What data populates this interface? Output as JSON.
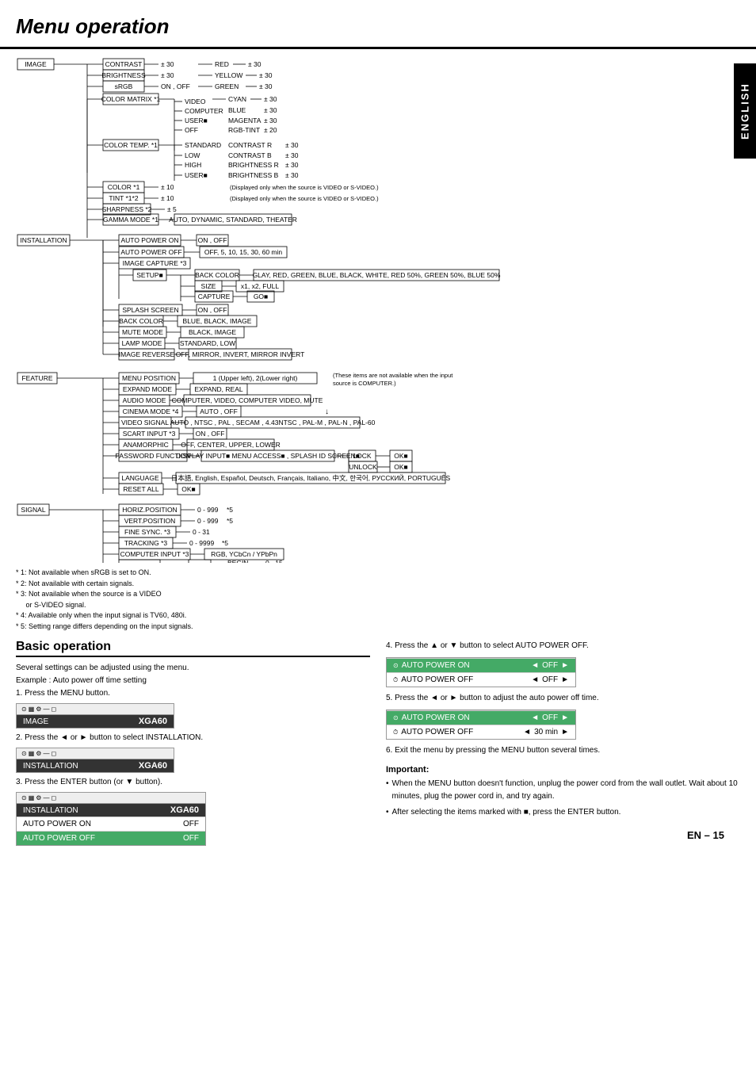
{
  "page": {
    "title": "Menu operation",
    "page_number": "EN – 15",
    "sidebar_label": "ENGLISH"
  },
  "notes": [
    "* 1: Not available when sRGB is set to ON.",
    "* 2: Not available with certain signals.",
    "* 3: Not available when the source is a VIDEO or S-VIDEO signal.",
    "* 4: Available only when the input signal is TV60, 480i.",
    "* 5: Setting range differs depending on the input signals."
  ],
  "basic_operation": {
    "title": "Basic operation",
    "intro": "Several settings can be adjusted using the menu.",
    "example": "Example : Auto power off time setting",
    "steps": [
      "1.  Press the MENU button.",
      "2.  Press the ◄ or ► button to select INSTALLATION.",
      "3.  Press the ENTER button (or ▼ button).",
      "4.  Press the ▲ or ▼ button to select AUTO POWER OFF.",
      "5.  Press the ◄ or ► button to adjust the auto power off time.",
      "6.  Exit the menu by pressing the MENU button several times."
    ],
    "xga_label": "XGA60"
  },
  "important": {
    "title": "Important:",
    "bullets": [
      "When the MENU button doesn't function, unplug the power cord from the wall outlet. Wait about 10 minutes, plug the power cord in, and try again.",
      "After selecting the items marked with ■, press the ENTER button."
    ]
  },
  "menu_mockups": [
    {
      "id": "mockup1",
      "bar_label": "IMAGE",
      "xga": "XGA60"
    },
    {
      "id": "mockup2",
      "bar_label": "INSTALLATION",
      "xga": "XGA60"
    },
    {
      "id": "mockup3",
      "bar_label": "INSTALLATION",
      "xga": "XGA60",
      "rows": [
        {
          "label": "AUTO POWER ON",
          "value": "OFF",
          "highlighted": false
        },
        {
          "label": "AUTO POWER OFF",
          "value": "OFF",
          "highlighted": true
        }
      ]
    },
    {
      "id": "mockup4",
      "bar_label": "AUTO POWER",
      "rows": [
        {
          "label": "ON",
          "value": "OFF",
          "highlighted": false
        },
        {
          "label": "AUTO POWER OFF",
          "value": "OFF",
          "highlighted": false
        }
      ]
    },
    {
      "id": "mockup5",
      "bar_label": "AUTO POWER",
      "rows": [
        {
          "label": "ON",
          "value": "OFF",
          "highlighted": false
        },
        {
          "label": "AUTO POWER OFF",
          "value": "30 min",
          "highlighted": false
        }
      ]
    }
  ]
}
